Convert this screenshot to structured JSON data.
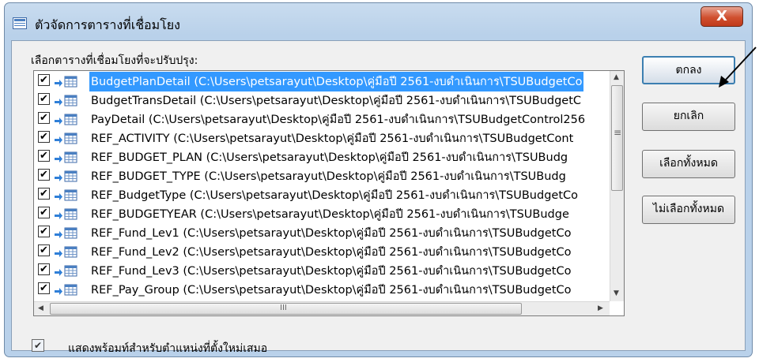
{
  "window": {
    "title": "ตัวจัดการตารางที่เชื่อมโยง",
    "close_label": "X"
  },
  "list": {
    "label": "เลือกตารางที่เชื่อมโยงที่จะปรับปรุง:",
    "items": [
      {
        "text": "BudgetPlanDetail   (C:\\Users\\petsarayut\\Desktop\\คู่มือปี   2561-งบดำเนินการ\\TSUBudgetCo",
        "checked": true,
        "selected": true
      },
      {
        "text": "BudgetTransDetail   (C:\\Users\\petsarayut\\Desktop\\คู่มือปี   2561-งบดำเนินการ\\TSUBudgetC",
        "checked": true,
        "selected": false
      },
      {
        "text": "PayDetail   (C:\\Users\\petsarayut\\Desktop\\คู่มือปี   2561-งบดำเนินการ\\TSUBudgetControl256",
        "checked": true,
        "selected": false
      },
      {
        "text": "REF_ACTIVITY   (C:\\Users\\petsarayut\\Desktop\\คู่มือปี   2561-งบดำเนินการ\\TSUBudgetCont",
        "checked": true,
        "selected": false
      },
      {
        "text": "REF_BUDGET_PLAN   (C:\\Users\\petsarayut\\Desktop\\คู่มือปี   2561-งบดำเนินการ\\TSUBudg",
        "checked": true,
        "selected": false
      },
      {
        "text": "REF_BUDGET_TYPE   (C:\\Users\\petsarayut\\Desktop\\คู่มือปี   2561-งบดำเนินการ\\TSUBudg",
        "checked": true,
        "selected": false
      },
      {
        "text": "REF_BudgetType   (C:\\Users\\petsarayut\\Desktop\\คู่มือปี   2561-งบดำเนินการ\\TSUBudgetCo",
        "checked": true,
        "selected": false
      },
      {
        "text": "REF_BUDGETYEAR   (C:\\Users\\petsarayut\\Desktop\\คู่มือปี   2561-งบดำเนินการ\\TSUBudge",
        "checked": true,
        "selected": false
      },
      {
        "text": "REF_Fund_Lev1   (C:\\Users\\petsarayut\\Desktop\\คู่มือปี   2561-งบดำเนินการ\\TSUBudgetCo",
        "checked": true,
        "selected": false
      },
      {
        "text": "REF_Fund_Lev2   (C:\\Users\\petsarayut\\Desktop\\คู่มือปี   2561-งบดำเนินการ\\TSUBudgetCo",
        "checked": true,
        "selected": false
      },
      {
        "text": "REF_Fund_Lev3   (C:\\Users\\petsarayut\\Desktop\\คู่มือปี   2561-งบดำเนินการ\\TSUBudgetCo",
        "checked": true,
        "selected": false
      },
      {
        "text": "REF_Pay_Group   (C:\\Users\\petsarayut\\Desktop\\คู่มือปี   2561-งบดำเนินการ\\TSUBudgetCo",
        "checked": true,
        "selected": false
      }
    ]
  },
  "buttons": {
    "ok": "ตกลง",
    "cancel": "ยกเลิก",
    "select_all": "เลือกทั้งหมด",
    "deselect_all": "ไม่เลือกทั้งหมด"
  },
  "footer": {
    "label": "แสดงพร้อมท์สำหรับตำแหน่งที่ตั้งใหม่เสมอ",
    "checked": true
  },
  "icons": {
    "window": "linked-table-manager-icon",
    "table": "linked-table-icon",
    "checkmark": "✔"
  }
}
